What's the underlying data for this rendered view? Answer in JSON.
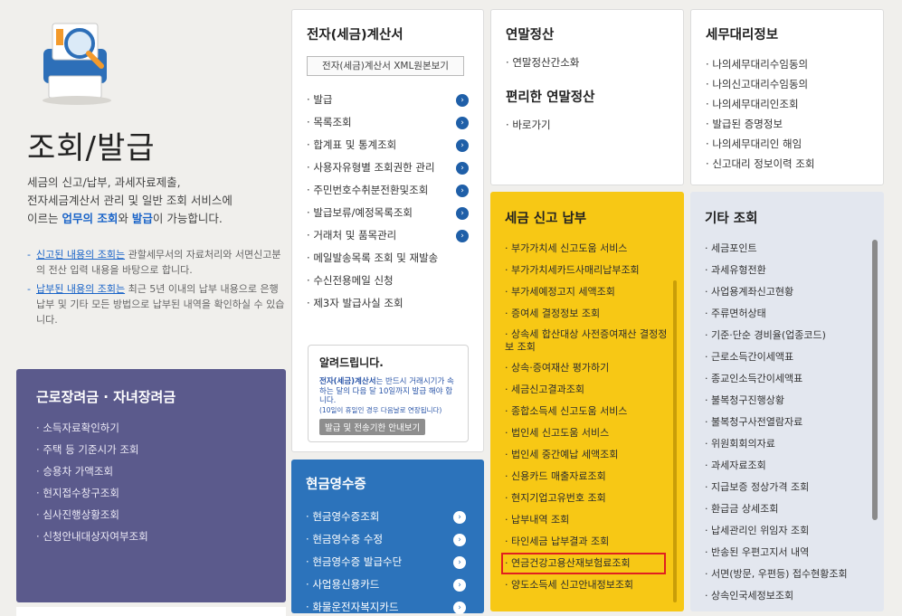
{
  "hero": {
    "title": "조회/발급",
    "desc_line1": "세금의 신고/납부, 과세자료제출,",
    "desc_line2": "전자세금계산서 관리 및 일반 조회 서비스에",
    "desc_line3_pre": "이르는 ",
    "desc_hl1": "업무의 조회",
    "desc_mid": "와 ",
    "desc_hl2": "발급",
    "desc_post": "이 가능합니다.",
    "note1_u": "신고된 내용의 조회는",
    "note1_rest": " 관할세무서의 자료처리와 서면신고분의 전산 입력 내용을 바탕으로 합니다.",
    "note2_u": "납부된 내용의 조회는",
    "note2_rest": " 최근 5년 이내의 납부 내용으로 은행 납부 및 기타 모든 방법으로 납부된 내역을 확인하실 수 있습니다."
  },
  "purple": {
    "title": "근로장려금 · 자녀장려금",
    "items": [
      "소득자료확인하기",
      "주택 등 기준시가 조회",
      "승용차 가액조회",
      "현지접수창구조회",
      "심사진행상황조회",
      "신청안내대상자여부조회"
    ]
  },
  "einv": {
    "title": "전자(세금)계산서",
    "xml_button": "전자(세금)계산서 XML원본보기",
    "items": [
      "발급",
      "목록조회",
      "합계표 및 통계조회",
      "사용자유형별 조회권한 관리",
      "주민번호수취분전환및조회",
      "발급보류/예정목록조회",
      "거래처 및 품목관리",
      "메일발송목록 조회 및 재발송",
      "수신전용메일 신청",
      "제3자 발급사실 조회"
    ]
  },
  "notice": {
    "title": "알려드립니다.",
    "text_hl": "전자(세금)계산서",
    "text": "는 반드시 거래시기가 속하는 달의 다음 달 10일까지 발급 해야 합니다.",
    "small": "(10일이 휴일인 경우 다음날로 연장됩니다)",
    "button": "발급 및 전송기한 안내보기"
  },
  "cash": {
    "title": "현금영수증",
    "items": [
      "현금영수증조회",
      "현금영수증 수정",
      "현금영수증 발급수단",
      "사업용신용카드",
      "화물운전자복지카드"
    ]
  },
  "yearend": {
    "title": "연말정산",
    "item": "연말정산간소화",
    "title2": "편리한 연말정산",
    "item2": "바로가기"
  },
  "yellow": {
    "title": "세금 신고 납부",
    "items": [
      "부가가치세 신고도움 서비스",
      "부가가치세카드사매리납부조회",
      "부가세예정고지 세액조회",
      "증여세 결정정보 조회",
      "상속세 합산대상 사전증여재산 결정정보 조회",
      "상속·증여재산 평가하기",
      "세금신고결과조회",
      "종합소득세 신고도움 서비스",
      "법인세 신고도움 서비스",
      "법인세 중간예납 세액조회",
      "신용카드 매출자료조회",
      "현지기업고유번호 조회",
      "납부내역 조회",
      "타인세금 납부결과 조회",
      "연금건강고용산재보험료조회",
      "양도소득세 신고안내정보조회"
    ]
  },
  "agent": {
    "title": "세무대리정보",
    "items": [
      "나의세무대리수임동의",
      "나의신고대리수임동의",
      "나의세무대리인조회",
      "발급된 증명정보",
      "나의세무대리인 해임",
      "신고대리 정보이력 조회"
    ]
  },
  "other": {
    "title": "기타 조회",
    "items": [
      "세금포인트",
      "과세유형전환",
      "사업용계좌신고현황",
      "주류면허상태",
      "기준·단순 경비율(업종코드)",
      "근로소득간이세액표",
      "종교인소득간이세액표",
      "불복청구진행상황",
      "불복청구사전열람자료",
      "위원회회의자료",
      "과세자료조회",
      "지급보증 정상가격 조회",
      "환급금 상세조회",
      "납세관리인 위임자 조회",
      "반송된 우편고지서 내역",
      "서면(방문, 우편등) 접수현황조회",
      "상속인국세정보조회"
    ]
  }
}
